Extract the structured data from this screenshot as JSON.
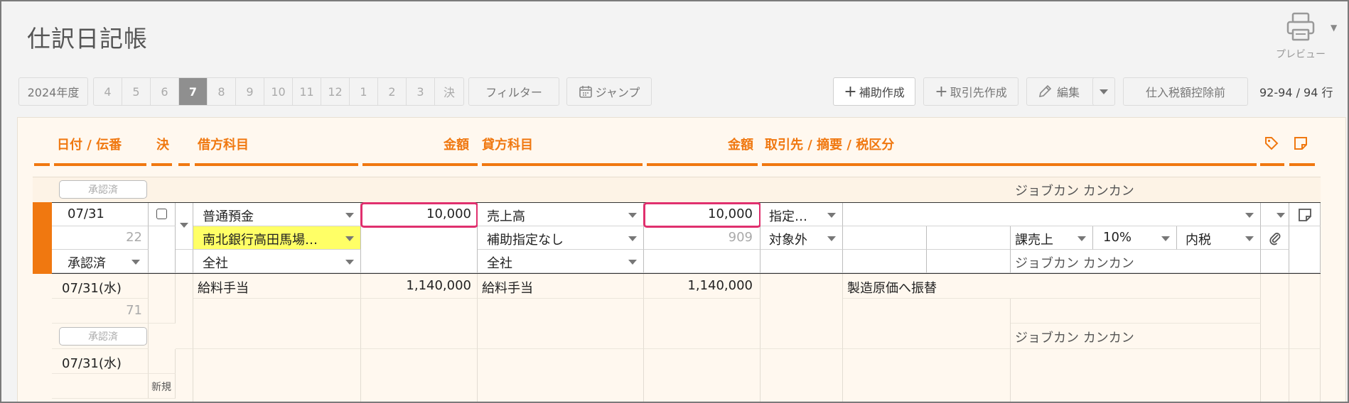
{
  "header": {
    "title": "仕訳日記帳",
    "preview_label": "プレビュー"
  },
  "toolbar": {
    "fiscal_year": "2024年度",
    "months": [
      "4",
      "5",
      "6",
      "7",
      "8",
      "9",
      "10",
      "11",
      "12",
      "1",
      "2",
      "3",
      "決"
    ],
    "active_month": "7",
    "filter_label": "フィルター",
    "jump_label": "ジャンプ",
    "add_sub_label": "補助作成",
    "add_partner_label": "取引先作成",
    "edit_label": "編集",
    "tax_label": "仕入税額控除前",
    "row_count": "92-94 / 94 行"
  },
  "columns": {
    "date": "日付 / 伝番",
    "settle": "決",
    "debit_account": "借方科目",
    "debit_amount": "金額",
    "credit_account": "貸方科目",
    "credit_amount": "金額",
    "partner": "取引先 / 摘要 / 税区分"
  },
  "rows": {
    "r0": {
      "status": "承認済",
      "user": "ジョブカン カンカン"
    },
    "edit": {
      "date": "07/31",
      "slip_no": "22",
      "status": "承認済",
      "debit_account": "普通預金",
      "debit_sub": "南北銀行高田馬場…",
      "debit_dept": "全社",
      "debit_amount": "10,000",
      "credit_account": "売上高",
      "credit_sub": "補助指定なし",
      "credit_dept": "全社",
      "credit_amount": "10,000",
      "credit_code": "909",
      "partner": "指定…",
      "tax_scope": "対象外",
      "tax_type": "課売上",
      "tax_rate": "10%",
      "tax_incl": "内税",
      "user": "ジョブカン カンカン"
    },
    "r2": {
      "date": "07/31(水)",
      "slip_no": "71",
      "debit_account": "給料手当",
      "debit_amount": "1,140,000",
      "credit_account": "給料手当",
      "credit_amount": "1,140,000",
      "memo": "製造原価へ振替",
      "status": "承認済",
      "user": "ジョブカン カンカン"
    },
    "r3": {
      "date": "07/31(水)",
      "new_label": "新規"
    }
  }
}
